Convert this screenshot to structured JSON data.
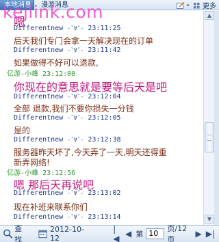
{
  "tabs": {
    "local": "本地消息",
    "roam": "漫游消息"
  },
  "toolbar": {
    "more": "更多"
  },
  "watermark": "kejiink.com",
  "messages": [
    {
      "type": "text",
      "text": "嗯",
      "color": "#c0147d",
      "size": 17
    },
    {
      "type": "header",
      "name": "Differentnew",
      "emote": "-ˇ∀ˇ-",
      "time": "23:11:25",
      "color": "#1d3a8a"
    },
    {
      "type": "text",
      "text": "后天我们专门会拿一天解决现在的订单",
      "color": "#7a2d12",
      "size": 12
    },
    {
      "type": "header",
      "name": "Differentnew",
      "emote": "-ˇ∀ˇ-",
      "time": "23:11:42",
      "color": "#1d3a8a"
    },
    {
      "type": "text",
      "text": "如果做得不好可以退款,",
      "color": "#7a2d12",
      "size": 12
    },
    {
      "type": "header",
      "name": "亿游-小峰",
      "time": "23:12:00",
      "color": "#2f9b2f"
    },
    {
      "type": "text",
      "text": "你现在的意思就是要等后天是吧",
      "color": "#c0147d",
      "size": 16
    },
    {
      "type": "header",
      "name": "Differentnew",
      "emote": "-ˇ∀ˇ-",
      "time": "23:12:04",
      "color": "#1d3a8a"
    },
    {
      "type": "text",
      "text": "全部 退款,我们不要你损失一分钱",
      "color": "#7a2d12",
      "size": 12
    },
    {
      "type": "header",
      "name": "Differentnew",
      "emote": "-ˇ∀ˇ-",
      "time": "23:12:05",
      "color": "#1d3a8a"
    },
    {
      "type": "text",
      "text": "是的",
      "color": "#7a2d12",
      "size": 12
    },
    {
      "type": "header",
      "name": "Differentnew",
      "emote": "-ˇ∀ˇ-",
      "time": "23:12:38",
      "color": "#1d3a8a"
    },
    {
      "type": "text",
      "text": "服务器昨天坏了,今天弄了一天,明天还得重",
      "color": "#7a2d12",
      "size": 12
    },
    {
      "type": "text",
      "text": "新弄网络!",
      "color": "#7a2d12",
      "size": 12
    },
    {
      "type": "header",
      "name": "亿游-小峰",
      "time": "23:12:56",
      "color": "#2f9b2f"
    },
    {
      "type": "text",
      "text": "嗯 那后天再说吧",
      "color": "#c0147d",
      "size": 16
    },
    {
      "type": "header",
      "name": "Differentnew",
      "emote": "-ˇ∀ˇ-",
      "time": "23:13:02",
      "color": "#1d3a8a"
    },
    {
      "type": "text",
      "text": "现在补班来联系你们",
      "color": "#7a2d12",
      "size": 12
    },
    {
      "type": "header",
      "name": "Differentnew",
      "emote": "-ˇ∀ˇ-",
      "time": "23:13:14",
      "color": "#1d3a8a"
    }
  ],
  "bottombar": {
    "search": "查找",
    "date": "2012-10-12",
    "page_prefix": "第",
    "page_value": "10",
    "page_suffix": "页/12页"
  }
}
